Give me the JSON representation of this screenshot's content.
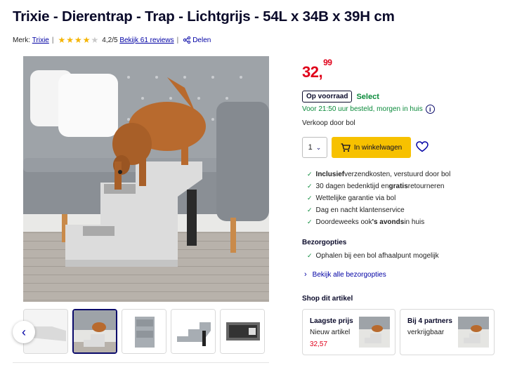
{
  "product": {
    "title": "Trixie - Dierentrap - Trap - Lichtgrijs - 54L x 34B x 39H cm"
  },
  "meta": {
    "brand_label": "Merk:",
    "brand": "Trixie",
    "rating": "4,2/5",
    "rating_value": 4.2,
    "rating_max": 5,
    "reviews_link": "Bekijk 61 reviews",
    "share_label": "Delen"
  },
  "buybox": {
    "price_main": "32,",
    "price_cents": "99",
    "stock_badge": "Op voorraad",
    "select_label": "Select",
    "delivery": "Voor 21:50 uur besteld, morgen in huis",
    "seller": "Verkoop door bol",
    "quantity": "1",
    "cart_button": "In winkelwagen"
  },
  "usps": [
    {
      "pre": "",
      "bold": "Inclusief",
      "post": " verzendkosten, verstuurd door bol"
    },
    {
      "pre": "30 dagen bedenktijd en ",
      "bold": "gratis",
      "post": " retourneren"
    },
    {
      "pre": "Wettelijke garantie via bol",
      "bold": "",
      "post": ""
    },
    {
      "pre": "Dag en nacht klantenservice",
      "bold": "",
      "post": ""
    },
    {
      "pre": "Doordeweeks ook ",
      "bold": "'s avonds",
      "post": " in huis"
    }
  ],
  "shipping": {
    "heading": "Bezorgopties",
    "option": "Ophalen bij een bol afhaalpunt mogelijk",
    "all_link": "Bekijk alle bezorgopties"
  },
  "shop": {
    "heading": "Shop dit artikel",
    "cards": [
      {
        "title": "Laagste prijs",
        "sub": "Nieuw artikel",
        "price": "32,57"
      },
      {
        "title": "Bij 4 partners",
        "sub": "verkrijgbaar",
        "price": ""
      }
    ]
  },
  "gallery": {
    "thumb_count": 5,
    "active_index": 1
  },
  "colors": {
    "price_red": "#e0001a",
    "accent_green": "#0a8a3a",
    "link_blue": "#0000a4",
    "cart_yellow": "#f7c100"
  },
  "icons": [
    "star-icon",
    "share-icon",
    "info-icon",
    "chevron-down-icon",
    "cart-icon",
    "heart-icon",
    "check-icon",
    "chevron-right-icon",
    "chevron-left-icon"
  ]
}
